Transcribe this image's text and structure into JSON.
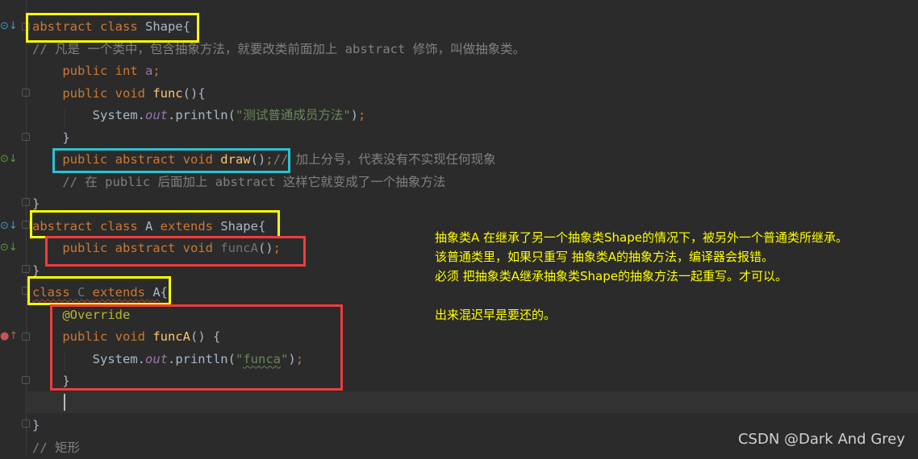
{
  "editor": {
    "lines": [
      {
        "id": "l1",
        "segments": [
          {
            "t": "abstract class ",
            "c": "kw"
          },
          {
            "t": "Shape",
            "c": "cls"
          },
          {
            "t": "{",
            "c": "cls"
          }
        ]
      },
      {
        "id": "l2",
        "segments": [
          {
            "t": "// 凡是 一个类中，包含抽象方法，就要改类前面加上 abstract 修饰，叫做抽象类。",
            "c": "cmt"
          }
        ]
      },
      {
        "id": "l3",
        "segments": [
          {
            "t": "    public int ",
            "c": "kw"
          },
          {
            "t": "a",
            "c": "fld"
          },
          {
            "t": ";",
            "c": "kw"
          }
        ]
      },
      {
        "id": "l4",
        "segments": [
          {
            "t": "    public void ",
            "c": "kw"
          },
          {
            "t": "func",
            "c": "fn"
          },
          {
            "t": "(){",
            "c": "cls"
          }
        ]
      },
      {
        "id": "l5",
        "segments": [
          {
            "t": "        System.",
            "c": "cls"
          },
          {
            "t": "out",
            "c": "fld italic"
          },
          {
            "t": ".println(",
            "c": "cls"
          },
          {
            "t": "\"测试普通成员方法\"",
            "c": "str"
          },
          {
            "t": ")",
            "c": "cls"
          },
          {
            "t": ";",
            "c": "kw"
          }
        ]
      },
      {
        "id": "l6",
        "segments": [
          {
            "t": "    }",
            "c": "cls"
          }
        ]
      },
      {
        "id": "l7",
        "segments": [
          {
            "t": "    public abstract void ",
            "c": "kw"
          },
          {
            "t": "draw",
            "c": "fn"
          },
          {
            "t": "()",
            "c": "cls"
          },
          {
            "t": ";",
            "c": "kw"
          },
          {
            "t": "// 加上分号，代表没有不实现任何现象",
            "c": "cmt"
          }
        ]
      },
      {
        "id": "l8",
        "segments": [
          {
            "t": "    // 在 public 后面加上 abstract 这样它就变成了一个抽象方法",
            "c": "cmt"
          }
        ]
      },
      {
        "id": "l9",
        "segments": [
          {
            "t": "}",
            "c": "cls"
          }
        ]
      },
      {
        "id": "l10",
        "segments": [
          {
            "t": "abstract class ",
            "c": "kw"
          },
          {
            "t": "A ",
            "c": "cls"
          },
          {
            "t": "extends ",
            "c": "kw"
          },
          {
            "t": "Shape",
            "c": "cls"
          },
          {
            "t": "{",
            "c": "cls"
          }
        ]
      },
      {
        "id": "l11",
        "segments": [
          {
            "t": "    public abstract void ",
            "c": "kw"
          },
          {
            "t": "funcA",
            "c": "unused"
          },
          {
            "t": "()",
            "c": "cls"
          },
          {
            "t": ";",
            "c": "kw"
          }
        ]
      },
      {
        "id": "l12",
        "segments": [
          {
            "t": "}",
            "c": "cls"
          }
        ]
      },
      {
        "id": "l13",
        "segments": [
          {
            "t": "class ",
            "c": "kw squig-red"
          },
          {
            "t": "C ",
            "c": "unused squig-red"
          },
          {
            "t": "extends ",
            "c": "kw squig-red"
          },
          {
            "t": "A",
            "c": "cls squig-red"
          },
          {
            "t": "{",
            "c": "cls"
          }
        ]
      },
      {
        "id": "l14",
        "segments": [
          {
            "t": "    @Override",
            "c": "ann"
          }
        ]
      },
      {
        "id": "l15",
        "segments": [
          {
            "t": "    public void ",
            "c": "kw"
          },
          {
            "t": "funcA",
            "c": "fn"
          },
          {
            "t": "() {",
            "c": "cls"
          }
        ]
      },
      {
        "id": "l16",
        "segments": [
          {
            "t": "        System.",
            "c": "cls"
          },
          {
            "t": "out",
            "c": "fld italic"
          },
          {
            "t": ".println(",
            "c": "cls"
          },
          {
            "t": "\"",
            "c": "str"
          },
          {
            "t": "funca",
            "c": "str squig-green"
          },
          {
            "t": "\"",
            "c": "str"
          },
          {
            "t": ")",
            "c": "cls"
          },
          {
            "t": ";",
            "c": "kw"
          }
        ]
      },
      {
        "id": "l17",
        "segments": [
          {
            "t": "    }",
            "c": "cls"
          }
        ]
      },
      {
        "id": "l18",
        "segments": [
          {
            "t": "",
            "c": "cls"
          }
        ]
      },
      {
        "id": "l19",
        "segments": [
          {
            "t": "}",
            "c": "cls"
          }
        ]
      },
      {
        "id": "l20",
        "segments": [
          {
            "t": "// 矩形",
            "c": "cmt"
          }
        ]
      }
    ]
  },
  "gutter_icons": [
    {
      "line": 1,
      "icon": "implemented-by-icon",
      "glyph": "⊙↓",
      "color": "#3d9ac7"
    },
    {
      "line": 7,
      "icon": "implemented-in-icon",
      "glyph": "⊙↓",
      "color": "#5b9c3a"
    },
    {
      "line": 10,
      "icon": "implemented-by-icon",
      "glyph": "⊙↓",
      "color": "#3d9ac7"
    },
    {
      "line": 11,
      "icon": "implemented-in-icon",
      "glyph": "⊙↓",
      "color": "#5b9c3a"
    },
    {
      "line": 15,
      "icon": "overrides-method-icon",
      "glyph": "●↑",
      "color": "#c75450"
    }
  ],
  "annotation_note": {
    "lines": [
      "抽象类A 在继承了另一个抽象类Shape的情况下，被另外一个普通类所继承。",
      "该普通类里，如果只重写 抽象类A的抽象方法，编译器会报错。",
      "必须 把抽象类A继承抽象类Shape的抽象方法一起重写。才可以。",
      "",
      "出来混迟早是要还的。"
    ],
    "color": "#ffff00"
  },
  "highlight_colors": {
    "yellow": "#ffff00",
    "cyan": "#27c4d3",
    "red": "#f03c3c"
  },
  "watermark": "CSDN @Dark And Grey"
}
